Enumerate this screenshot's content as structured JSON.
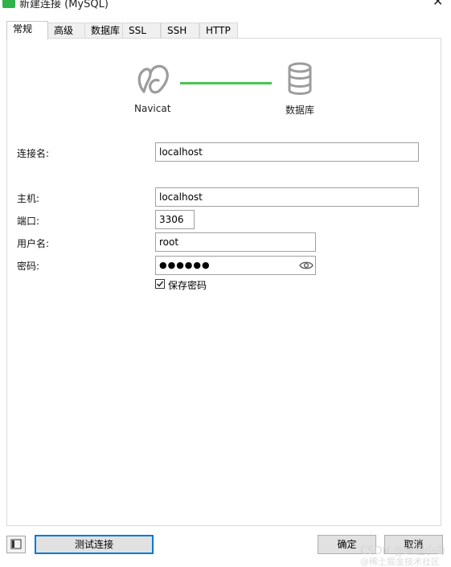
{
  "window": {
    "title": "新建连接 (MySQL)",
    "app_icon": "navicat-leaf-icon",
    "close_glyph": "✕"
  },
  "tabs": [
    {
      "label": "常规",
      "active": true
    },
    {
      "label": "高级"
    },
    {
      "label": "数据库"
    },
    {
      "label": "SSL"
    },
    {
      "label": "SSH"
    },
    {
      "label": "HTTP"
    }
  ],
  "diagram": {
    "left_caption": "Navicat",
    "right_caption": "数据库",
    "line_color": "#48c552",
    "icon_color": "#9c9c9c"
  },
  "form": {
    "connection_name": {
      "label": "连接名:",
      "value": "localhost"
    },
    "host": {
      "label": "主机:",
      "value": "localhost"
    },
    "port": {
      "label": "端口:",
      "value": "3306"
    },
    "username": {
      "label": "用户名:",
      "value": "root"
    },
    "password": {
      "label": "密码:",
      "masked": "●●●●●●"
    },
    "save_password": {
      "label": "保存密码",
      "checked": true
    }
  },
  "footer": {
    "test_button": "测试连接",
    "ok_button": "确定",
    "cancel_button": "取消",
    "accent": "#0078d7"
  },
  "watermark": {
    "line1": "CSDN @编程小白",
    "line2": "@稀土掘金技术社区"
  }
}
